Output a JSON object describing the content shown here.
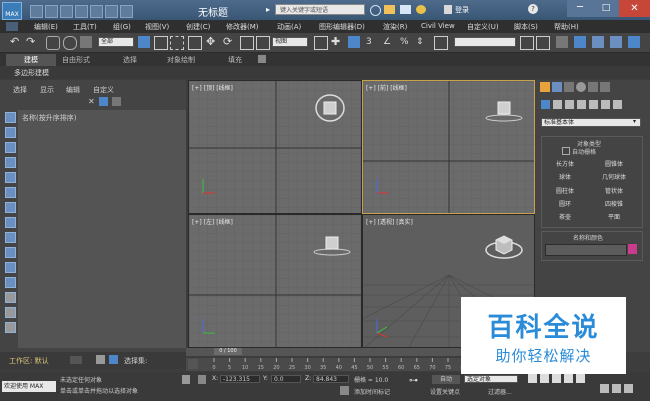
{
  "app": {
    "logo_text": "MAX",
    "title": "无标题",
    "search_placeholder": "键入关键字或短语",
    "login_label": "登录"
  },
  "menu": [
    "编辑(E)",
    "工具(T)",
    "组(G)",
    "视图(V)",
    "创建(C)",
    "修改器(M)",
    "动画(A)",
    "图形编辑器(D)",
    "渲染(R)",
    "Civil View",
    "自定义(U)",
    "脚本(S)",
    "帮助(H)"
  ],
  "toolbar": {
    "selection_filter": "全部",
    "coord_system": "视图"
  },
  "ribbon": {
    "tabs": [
      "建模",
      "自由形式",
      "选择",
      "对象绘制",
      "填充"
    ],
    "sub_label": "多边形建模"
  },
  "scene_explorer": {
    "tabs": [
      "选择",
      "显示",
      "编辑",
      "自定义"
    ],
    "header": "名称(按升序排序)",
    "workspace_label": "工作区: 默认",
    "selection_set_label": "选择集:"
  },
  "viewports": [
    {
      "label": "[+] [顶] [线框]"
    },
    {
      "label": "[+] [前] [线框]"
    },
    {
      "label": "[+] [左] [线框]"
    },
    {
      "label": "[+] [透视] [真实]"
    }
  ],
  "command_panel": {
    "category": "标准基本体",
    "object_type_title": "对象类型",
    "autogrid_label": "自动栅格",
    "buttons": [
      "长方体",
      "圆锥体",
      "球体",
      "几何球体",
      "圆柱体",
      "管状体",
      "圆环",
      "四棱锥",
      "茶壶",
      "平面"
    ],
    "name_color_title": "名称和颜色",
    "swatch_color": "#c73c8c"
  },
  "timeline": {
    "frame_display": "0 / 100",
    "tick_labels": [
      "0",
      "5",
      "10",
      "15",
      "20",
      "25",
      "30",
      "35",
      "40",
      "45",
      "50",
      "55",
      "60",
      "65",
      "70",
      "75",
      "80",
      "85",
      "90",
      "95",
      "100"
    ]
  },
  "status": {
    "welcome": "欢迎使用 MAX",
    "line1": "未选定任何对象",
    "line2": "单击或单击并拖动以选择对象",
    "x_value": "-123.315",
    "y_value": "0.0",
    "z_value": "84.843",
    "grid_label": "栅格 = 10.0",
    "add_time_tag": "添加时间标记",
    "auto_key": "自动",
    "selected_label": "选定对象",
    "set_key": "设置关键点",
    "key_filter": "过滤器..."
  },
  "watermark": {
    "title": "百科全说",
    "subtitle": "助你轻松解决"
  }
}
